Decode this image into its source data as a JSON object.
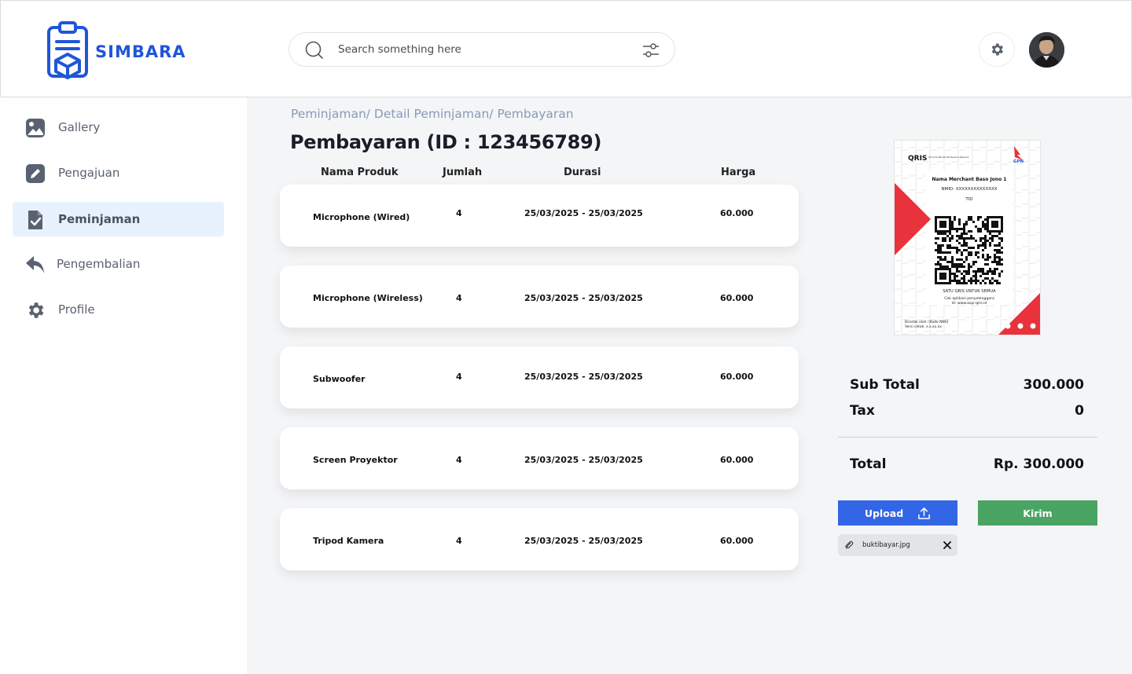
{
  "app": {
    "name": "SIMBARA"
  },
  "search": {
    "placeholder": "Search something here"
  },
  "sidebar": {
    "items": [
      {
        "label": "Gallery",
        "icon": "image-icon",
        "active": false
      },
      {
        "label": "Pengajuan",
        "icon": "edit-icon",
        "active": false
      },
      {
        "label": "Peminjaman",
        "icon": "document-check-icon",
        "active": true
      },
      {
        "label": "Pengembalian",
        "icon": "reply-icon",
        "active": false
      },
      {
        "label": "Profile",
        "icon": "gear-icon",
        "active": false
      }
    ]
  },
  "main": {
    "breadcrumb": "Peminjaman/ Detail Peminjaman/ Pembayaran",
    "title": "Pembayaran (ID : 123456789)",
    "columns": [
      "Nama Produk",
      "Jumlah",
      "Durasi",
      "Harga"
    ],
    "rows": [
      {
        "product": "Microphone (Wired)",
        "qty": "4",
        "duration": "25/03/2025 - 25/03/2025",
        "price": "60.000"
      },
      {
        "product": "Microphone (Wireless)",
        "qty": "4",
        "duration": "25/03/2025 - 25/03/2025",
        "price": "60.000"
      },
      {
        "product": "Subwoofer",
        "qty": "4",
        "duration": "25/03/2025 - 25/03/2025",
        "price": "60.000"
      },
      {
        "product": "Screen Proyektor",
        "qty": "4",
        "duration": "25/03/2025 - 25/03/2025",
        "price": "60.000"
      },
      {
        "product": "Tripod Kamera",
        "qty": "4",
        "duration": "25/03/2025 - 25/03/2025",
        "price": "60.000"
      }
    ]
  },
  "qris": {
    "brand": "QRIS",
    "header_small": "QR Code Standar Pembayaran Nasional",
    "gpn": "GPN",
    "merchant": "Nama Merchant Baso Jono 1",
    "nmid": "NMID: XXXXXXXXXXXXXX",
    "tid": "TID",
    "slogan": "SATU QRIS UNTUK SEMUA",
    "check_line1": "Cek aplikasi penyelenggara",
    "check_line2": "di: www.aspi-qris.id",
    "printed_by": "Dicetak oleh: [Kode NNS]",
    "version": "Versi cetak: x.x.xx.xx"
  },
  "summary": {
    "subtotal_label": "Sub Total",
    "subtotal_value": "300.000",
    "tax_label": "Tax",
    "tax_value": "0",
    "total_label": "Total",
    "total_value": "Rp. 300.000"
  },
  "actions": {
    "upload_label": "Upload",
    "send_label": "Kirim",
    "file_name": "buktibayar.jpg"
  },
  "colors": {
    "brand_blue": "#1f56d8",
    "upload_blue": "#3366e6",
    "send_green": "#4aa463",
    "qris_red": "#e8323c"
  }
}
